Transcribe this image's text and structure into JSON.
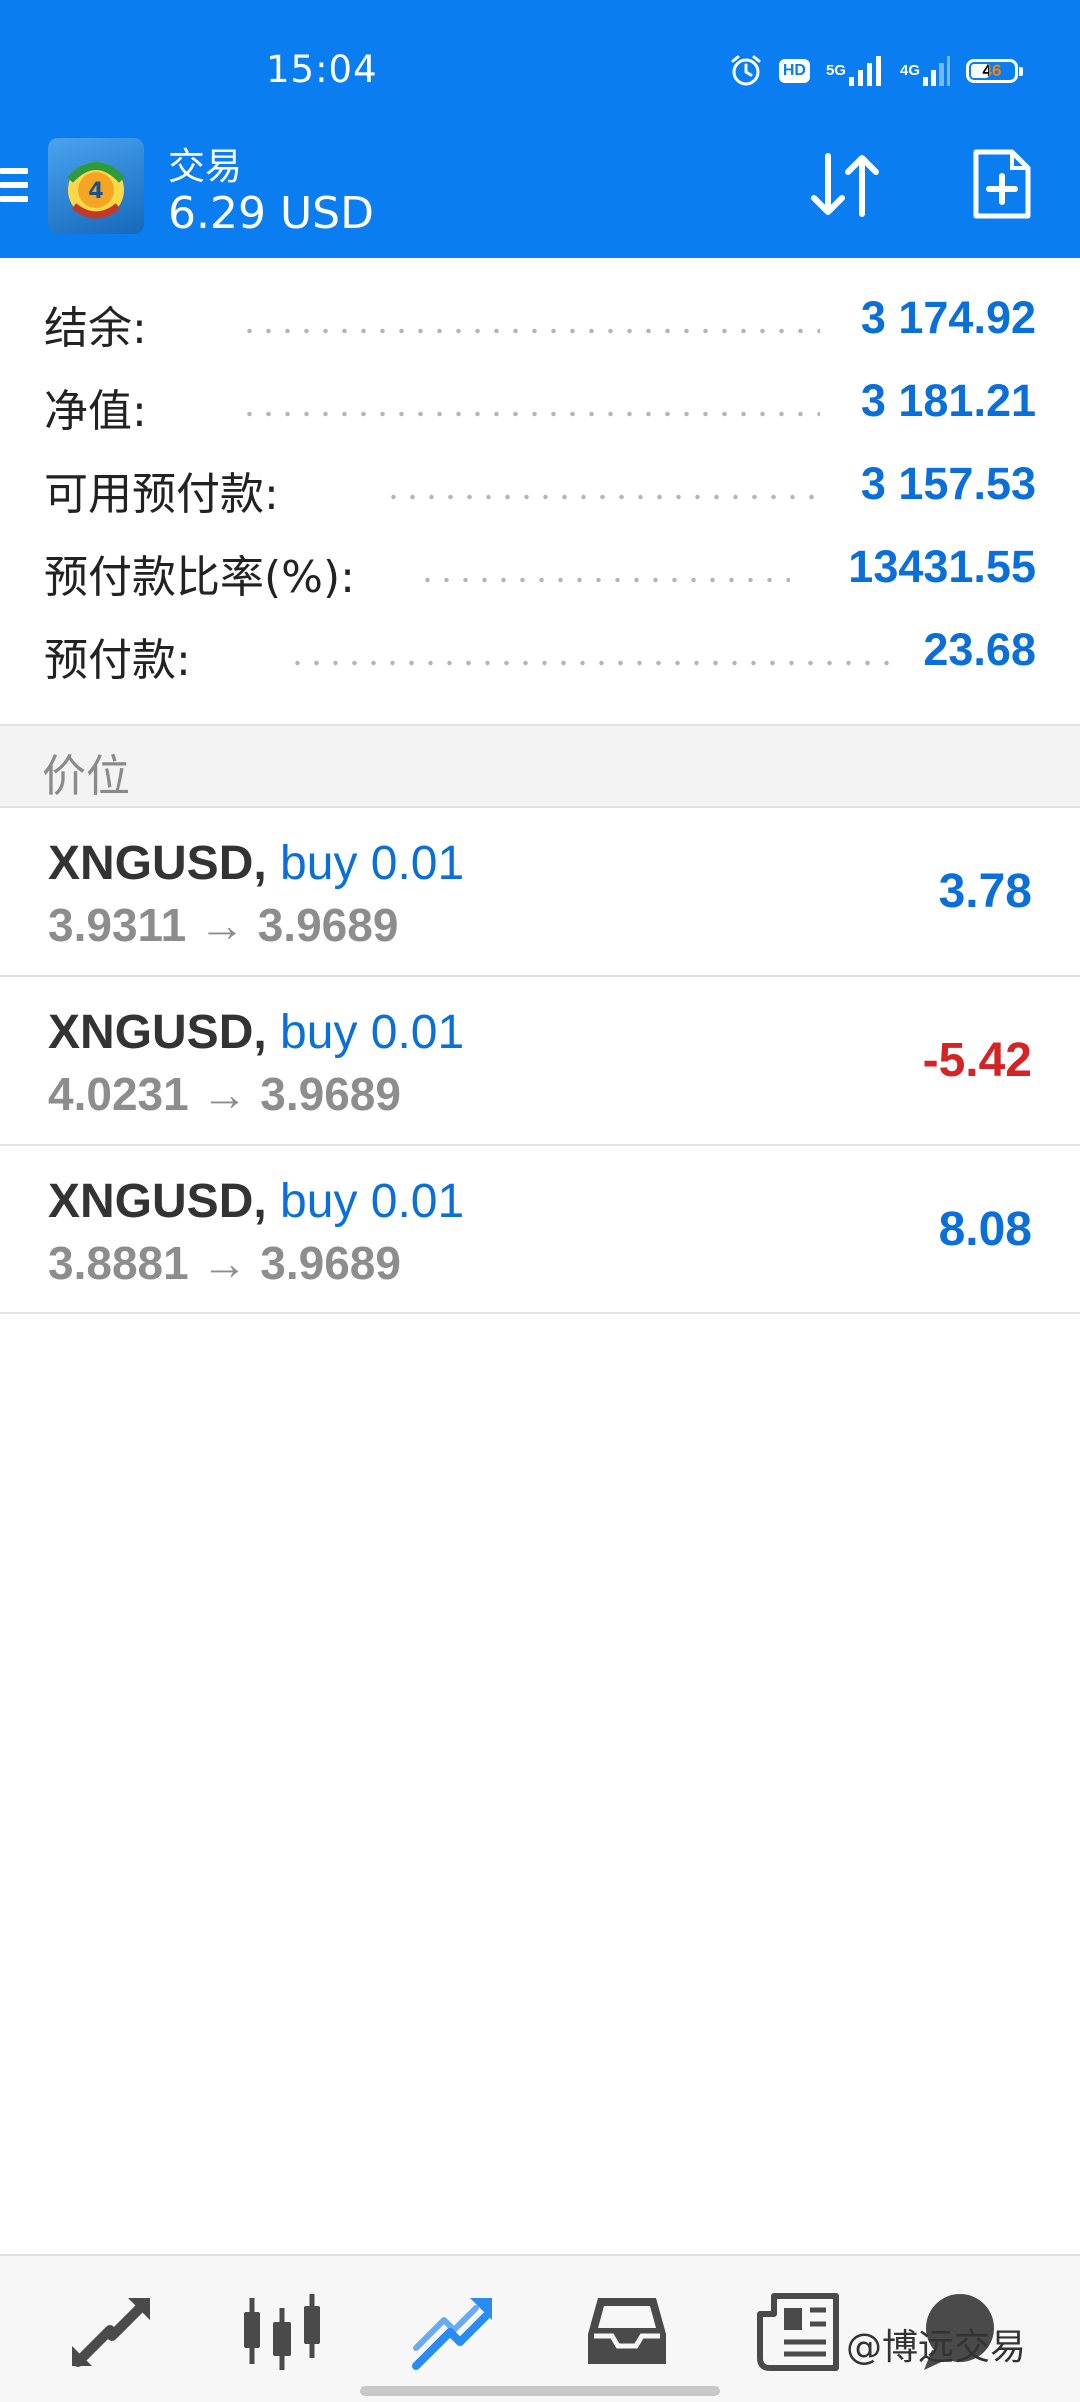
{
  "status_bar": {
    "time": "15:04",
    "hd_label": "HD",
    "net_5g": "5G",
    "net_4g": "4G",
    "battery_level": "46"
  },
  "app_bar": {
    "title": "交易",
    "subtitle": "6.29 USD",
    "accent": "#0a7ef1"
  },
  "summary": [
    {
      "label": "结余:",
      "value": "3 174.92"
    },
    {
      "label": "净值:",
      "value": "3 181.21"
    },
    {
      "label": "可用预付款:",
      "value": "3 157.53"
    },
    {
      "label": "预付款比率(%):",
      "value": "13431.55"
    },
    {
      "label": "预付款:",
      "value": "23.68"
    }
  ],
  "section": {
    "title": "价位"
  },
  "positions": [
    {
      "symbol": "XNGUSD,",
      "side": "buy 0.01",
      "prices": "3.9311 → 3.9689",
      "profit": "3.78",
      "profit_color": "#0a6fd9"
    },
    {
      "symbol": "XNGUSD,",
      "side": "buy 0.01",
      "prices": "4.0231 → 3.9689",
      "profit": "-5.42",
      "profit_color": "#d42424"
    },
    {
      "symbol": "XNGUSD,",
      "side": "buy 0.01",
      "prices": "3.8881 → 3.9689",
      "profit": "8.08",
      "profit_color": "#0a6fd9"
    }
  ],
  "bottom_nav": {
    "items": [
      {
        "icon": "quotes-icon"
      },
      {
        "icon": "chart-icon"
      },
      {
        "icon": "trade-icon",
        "active": true
      },
      {
        "icon": "history-icon"
      },
      {
        "icon": "news-icon"
      },
      {
        "icon": "messages-icon"
      }
    ],
    "watermark": "@博远交易"
  }
}
